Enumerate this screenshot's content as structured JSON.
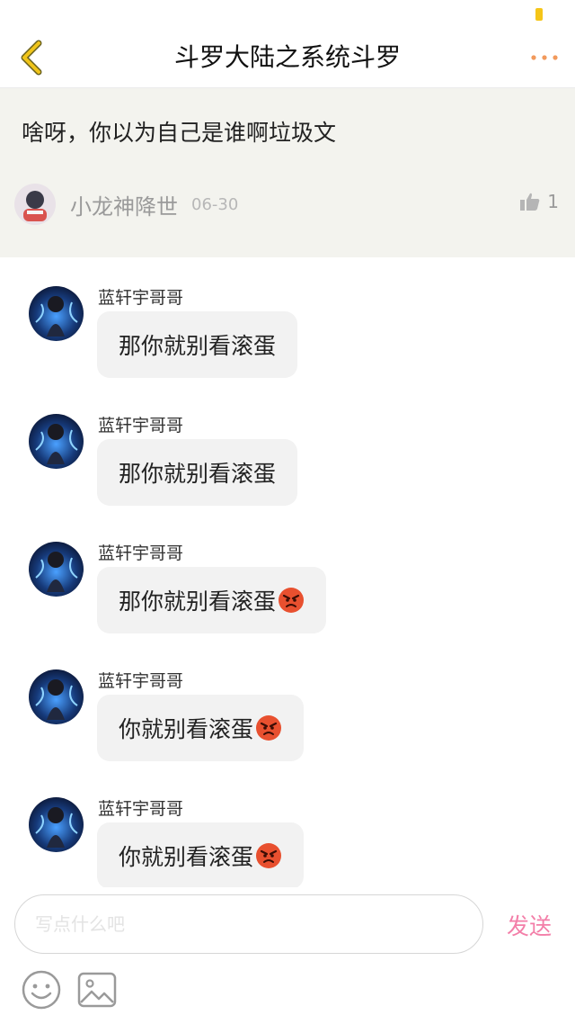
{
  "header": {
    "title": "斗罗大陆之系统斗罗",
    "back_icon": "chevron-left-icon",
    "more_icon": "more-dots-icon",
    "accent_color": "#f0c419"
  },
  "original_comment": {
    "text": "啥呀，你以为自己是谁啊垃圾文",
    "author": "小龙神降世",
    "date": "06-30",
    "likes": "1",
    "like_icon": "thumbs-up-icon"
  },
  "messages": [
    {
      "author": "蓝轩宇哥哥",
      "text": "那你就别看滚蛋",
      "emoji": false
    },
    {
      "author": "蓝轩宇哥哥",
      "text": "那你就别看滚蛋",
      "emoji": false
    },
    {
      "author": "蓝轩宇哥哥",
      "text": "那你就别看滚蛋",
      "emoji": true
    },
    {
      "author": "蓝轩宇哥哥",
      "text": "你就别看滚蛋",
      "emoji": true
    },
    {
      "author": "蓝轩宇哥哥",
      "text": "你就别看滚蛋",
      "emoji": true
    }
  ],
  "composer": {
    "placeholder": "写点什么吧",
    "send_label": "发送",
    "send_color": "#f37ea8",
    "emoji_icon": "smiley-icon",
    "image_icon": "image-icon"
  }
}
